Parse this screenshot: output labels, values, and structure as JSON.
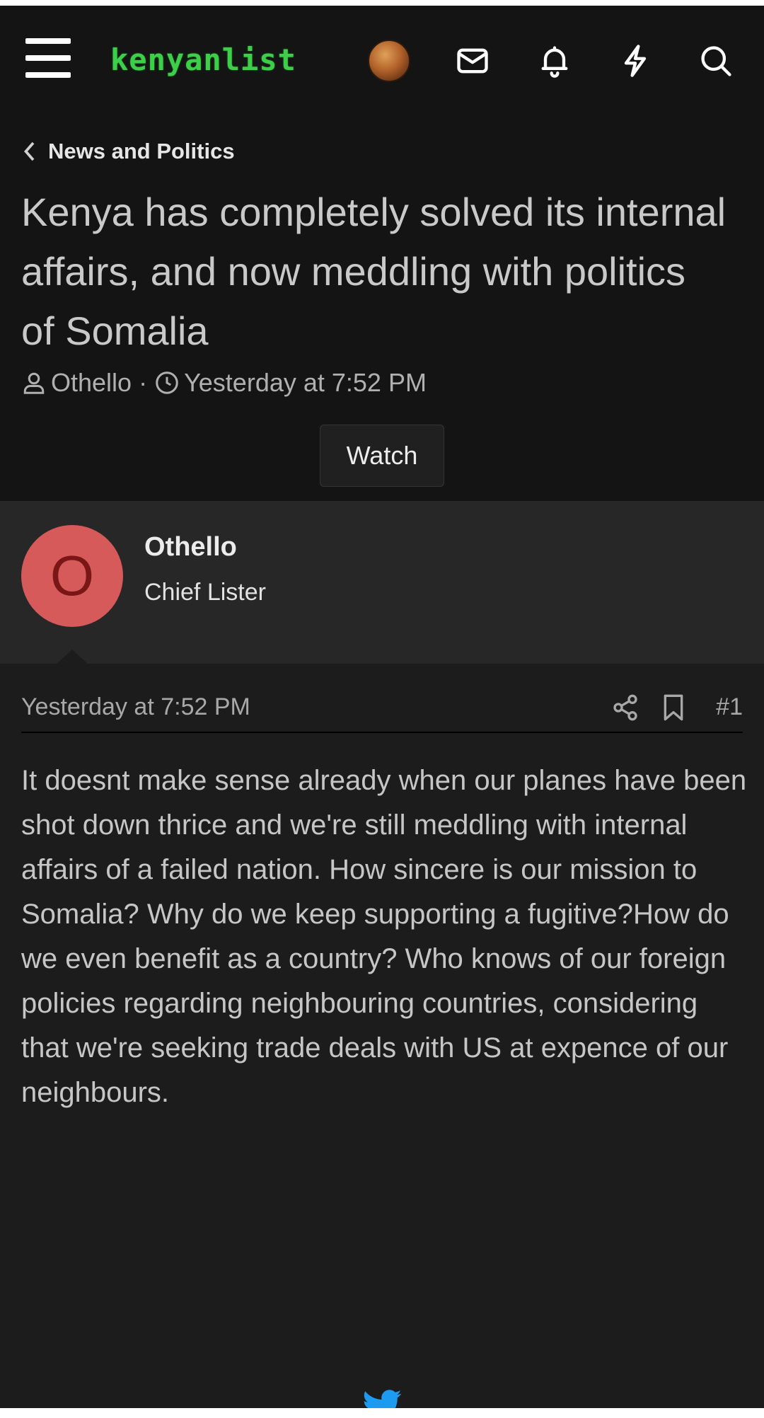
{
  "header": {
    "logo_text": "kenyanlist",
    "icons": [
      "menu-icon",
      "avatar",
      "mail-icon",
      "bell-icon",
      "lightning-icon",
      "search-icon"
    ]
  },
  "breadcrumb": {
    "label": "News and Politics"
  },
  "thread": {
    "title": "Kenya has completely solved its internal affairs, and now meddling with politics of Somalia",
    "author": "Othello",
    "separator": "·",
    "time": "Yesterday at 7:52 PM",
    "watch_label": "Watch"
  },
  "post": {
    "user_initial": "O",
    "username": "Othello",
    "user_title": "Chief Lister",
    "time": "Yesterday at 7:52 PM",
    "number": "#1",
    "body": "It doesnt make sense already when our planes have been shot down thrice and we're still meddling with internal affairs of a failed nation. How sincere is our mission to Somalia? Why do we keep supporting a fugitive?How do we even benefit as a country? Who knows of our foreign policies regarding neighbouring countries, considering that we're seeking trade deals with US at expence of our neighbours."
  },
  "colors": {
    "accent_logo": "#3ecf4a",
    "avatar_bg": "#d65a5a",
    "twitter": "#1d9bf0"
  }
}
